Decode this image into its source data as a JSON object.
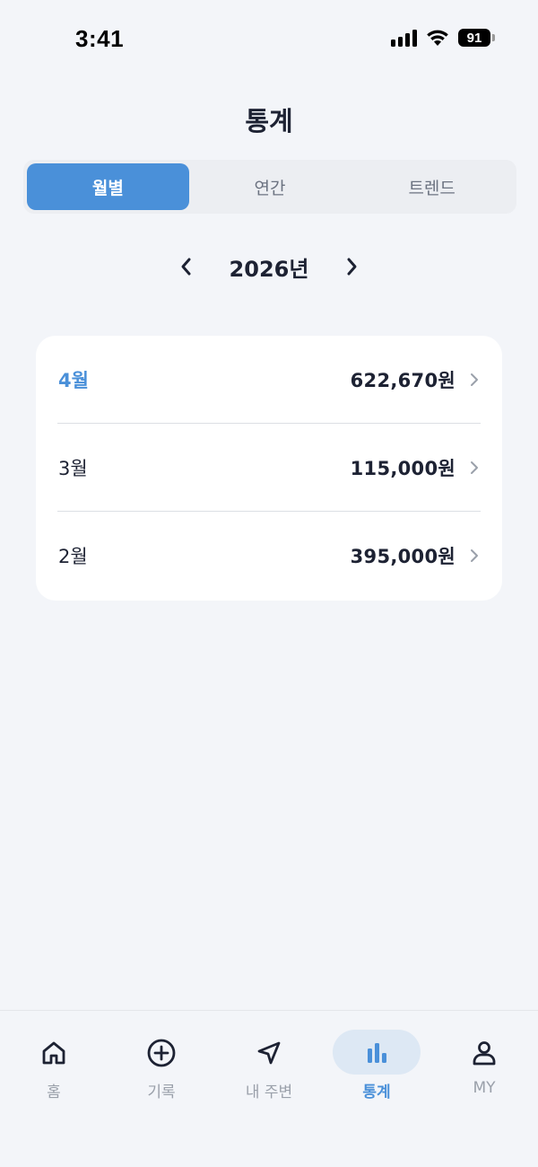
{
  "status_bar": {
    "time": "3:41",
    "battery": "91"
  },
  "header": {
    "title": "통계"
  },
  "tabs": [
    {
      "label": "월별",
      "active": true
    },
    {
      "label": "연간",
      "active": false
    },
    {
      "label": "트렌드",
      "active": false
    }
  ],
  "year_nav": {
    "year": "2026년"
  },
  "months": [
    {
      "label": "4월",
      "amount": "622,670원",
      "current": true
    },
    {
      "label": "3월",
      "amount": "115,000원",
      "current": false
    },
    {
      "label": "2월",
      "amount": "395,000원",
      "current": false
    }
  ],
  "bottom_nav": [
    {
      "label": "홈",
      "icon": "home-icon",
      "active": false
    },
    {
      "label": "기록",
      "icon": "plus-circle-icon",
      "active": false
    },
    {
      "label": "내 주변",
      "icon": "navigation-arrow-icon",
      "active": false
    },
    {
      "label": "통계",
      "icon": "bar-chart-icon",
      "active": true
    },
    {
      "label": "MY",
      "icon": "user-icon",
      "active": false
    }
  ],
  "colors": {
    "accent": "#4a90d9",
    "background": "#f3f5f9",
    "active_nav_pill": "#dde8f4",
    "text_primary": "#1d2233",
    "text_muted": "#9aa0aa"
  }
}
